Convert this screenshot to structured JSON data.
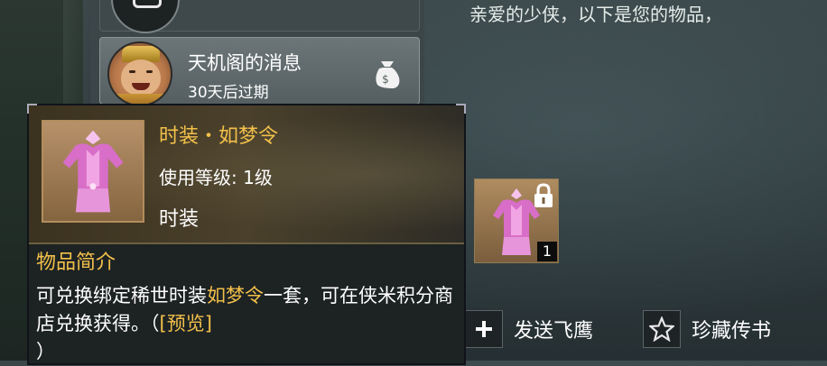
{
  "mail_list": {
    "selected": {
      "title": "天机阁的消息",
      "expire": "30天后过期",
      "attachment_icon": "money-bag-icon",
      "avatar": "merchant-avatar"
    }
  },
  "mail_detail": {
    "greeting": "亲爱的少侠，以下是您的物品，",
    "attachment": {
      "quantity": "1",
      "locked": true,
      "icon": "pink-costume-icon"
    }
  },
  "actions": {
    "send_label": "发送飞鹰",
    "favorite_label": "珍藏传书"
  },
  "tooltip": {
    "name": "时装・如梦令",
    "level": "使用等级: 1级",
    "type": "时装",
    "desc_title": "物品简介",
    "desc_part1": "可兑换绑定稀世时装",
    "desc_highlight": "如梦令",
    "desc_part2": "一套，可在侠米积分商店兑换获得。（",
    "preview_label": "[预览]",
    "desc_part3": "）"
  },
  "colors": {
    "highlight": "#f2c04b",
    "panel_bg": "#1d2223",
    "accent_border": "#b28d5c"
  }
}
